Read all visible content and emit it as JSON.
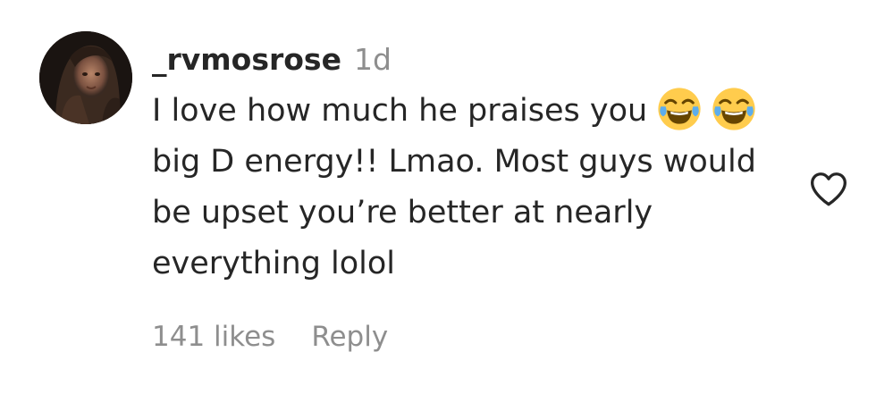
{
  "comment": {
    "username": "_rvmosrose",
    "time_ago": "1d",
    "text_segments": {
      "part1": "I love how much he praises you ",
      "part2": " ",
      "part3": " big D energy!! Lmao. Most guys would be upset you’re better at nearly everything lolol"
    },
    "emoji": "face-with-tears-of-joy",
    "likes_label": "141 likes",
    "reply_label": "Reply"
  },
  "icons": {
    "like": "heart-outline-icon",
    "avatar": "user-avatar"
  },
  "colors": {
    "text_primary": "#262626",
    "text_secondary": "#8e8e8e",
    "emoji_yellow": "#ffcc4d",
    "emoji_tears": "#5dadec"
  }
}
